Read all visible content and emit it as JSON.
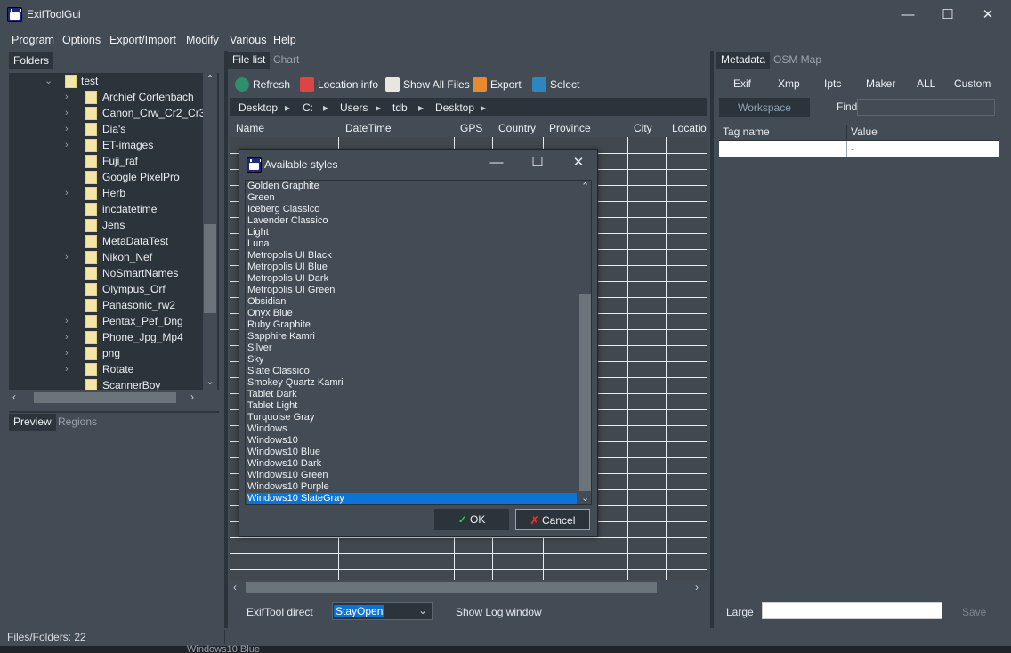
{
  "window": {
    "title": "ExifToolGui",
    "min": "—",
    "max": "☐",
    "close": "✕"
  },
  "menu": [
    "Program",
    "Options",
    "Export/Import",
    "Modify",
    "Various",
    "Help"
  ],
  "folders": {
    "tab": "Folders",
    "root": "test",
    "items": [
      {
        "label": "Archief Cortenbach",
        "expandable": true
      },
      {
        "label": "Canon_Crw_Cr2_Cr3",
        "expandable": true
      },
      {
        "label": "Dia's",
        "expandable": true
      },
      {
        "label": "ET-images",
        "expandable": true
      },
      {
        "label": "Fuji_raf",
        "expandable": false
      },
      {
        "label": "Google PixelPro",
        "expandable": false
      },
      {
        "label": "Herb",
        "expandable": true
      },
      {
        "label": "incdatetime",
        "expandable": false
      },
      {
        "label": "Jens",
        "expandable": false
      },
      {
        "label": "MetaDataTest",
        "expandable": false
      },
      {
        "label": "Nikon_Nef",
        "expandable": true
      },
      {
        "label": "NoSmartNames",
        "expandable": false
      },
      {
        "label": "Olympus_Orf",
        "expandable": false
      },
      {
        "label": "Panasonic_rw2",
        "expandable": false
      },
      {
        "label": "Pentax_Pef_Dng",
        "expandable": true
      },
      {
        "label": "Phone_Jpg_Mp4",
        "expandable": true
      },
      {
        "label": "png",
        "expandable": true
      },
      {
        "label": "Rotate",
        "expandable": true
      },
      {
        "label": "ScannerBoy",
        "expandable": false
      }
    ]
  },
  "preview_tabs": [
    "Preview",
    "Regions"
  ],
  "filelist": {
    "tabs": [
      "File list",
      "Chart"
    ],
    "toolbar": [
      "Refresh",
      "Location info",
      "Show All Files",
      "Export",
      "Select"
    ],
    "breadcrumb": [
      "Desktop",
      "C:",
      "Users",
      "tdb",
      "Desktop"
    ],
    "columns": [
      "Name",
      "DateTime",
      "GPS",
      "Country",
      "Province",
      "City",
      "Locatio"
    ],
    "exiftool_label": "ExifTool direct",
    "exiftool_mode": "StayOpen",
    "show_log": "Show Log window"
  },
  "dialog": {
    "title": "Available styles",
    "styles": [
      "Golden Graphite",
      "Green",
      "Iceberg Classico",
      "Lavender Classico",
      "Light",
      "Luna",
      "Metropolis UI Black",
      "Metropolis UI Blue",
      "Metropolis UI Dark",
      "Metropolis UI Green",
      "Obsidian",
      "Onyx Blue",
      "Ruby Graphite",
      "Sapphire Kamri",
      "Silver",
      "Sky",
      "Slate Classico",
      "Smokey Quartz Kamri",
      "Tablet Dark",
      "Tablet Light",
      "Turquoise Gray",
      "Windows",
      "Windows10",
      "Windows10 Blue",
      "Windows10 Dark",
      "Windows10 Green",
      "Windows10 Purple",
      "Windows10 SlateGray"
    ],
    "selected": "Windows10 SlateGray",
    "ok": "OK",
    "cancel": "Cancel"
  },
  "metadata": {
    "tabs": [
      "Metadata",
      "OSM Map"
    ],
    "groups": [
      "Exif",
      "Xmp",
      "Iptc",
      "Maker",
      "ALL",
      "Custom"
    ],
    "workspace": "Workspace",
    "find": "Find",
    "columns": [
      "Tag name",
      "Value"
    ],
    "row_value": "-",
    "large": "Large",
    "save": "Save"
  },
  "status": {
    "files_folders": "Files/Folders: 22",
    "behind": "Windows10 Blue"
  },
  "colors": {
    "bg": "#2b333b",
    "panel": "#434c55",
    "selection": "#0b74d6"
  }
}
